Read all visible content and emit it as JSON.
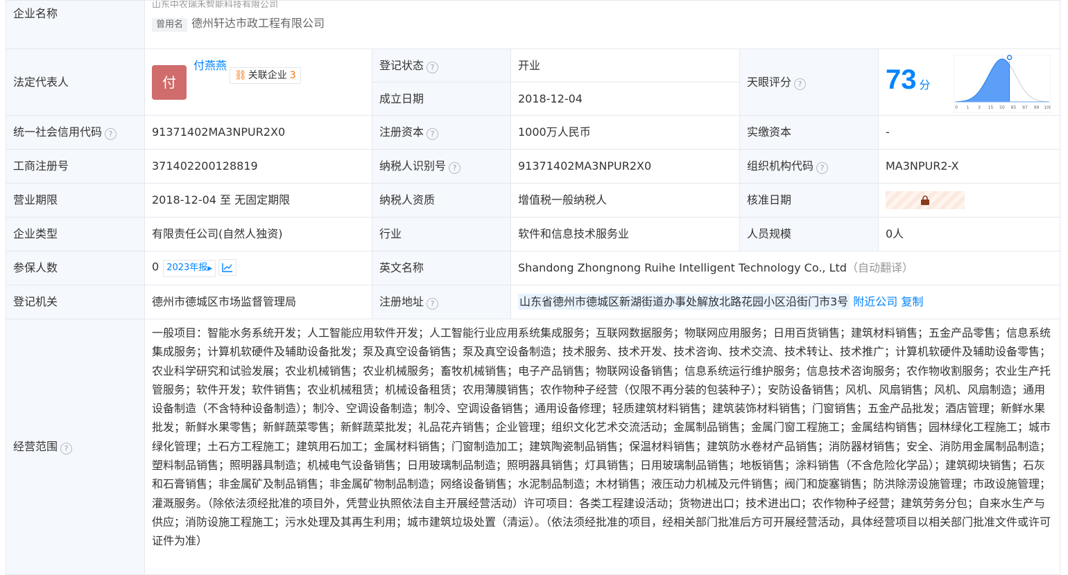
{
  "company_name": {
    "label": "企业名称",
    "current_name_partial": "山东中农瑞禾智能科技有限公司",
    "former_tag": "曾用名",
    "former_name": "德州轩达市政工程有限公司"
  },
  "legal": {
    "label": "法定代表人",
    "avatar_char": "付",
    "name": "付燕燕",
    "related_label": "关联企业",
    "related_count": "3"
  },
  "reg_status": {
    "label": "登记状态",
    "value": "开业"
  },
  "found_date": {
    "label": "成立日期",
    "value": "2018-12-04"
  },
  "score": {
    "label": "天眼评分",
    "value": "73",
    "unit": "分",
    "ticks": [
      "0",
      "1",
      "3",
      "15",
      "50",
      "85",
      "97",
      "99",
      "100"
    ],
    "marker_fraction": 0.58
  },
  "credit_code": {
    "label": "统一社会信用代码",
    "value": "91371402MA3NPUR2X0"
  },
  "reg_capital": {
    "label": "注册资本",
    "value": "1000万人民币"
  },
  "paid_capital": {
    "label": "实缴资本",
    "value": "-"
  },
  "biz_reg_no": {
    "label": "工商注册号",
    "value": "371402200128819"
  },
  "taxpayer_id": {
    "label": "纳税人识别号",
    "value": "91371402MA3NPUR2X0"
  },
  "org_code": {
    "label": "组织机构代码",
    "value": "MA3NPUR2-X"
  },
  "biz_term": {
    "label": "营业期限",
    "value": "2018-12-04 至 无固定期限"
  },
  "taxpayer_qual": {
    "label": "纳税人资质",
    "value": "增值税一般纳税人"
  },
  "approve_date": {
    "label": "核准日期"
  },
  "company_type": {
    "label": "企业类型",
    "value": "有限责任公司(自然人独资)"
  },
  "industry": {
    "label": "行业",
    "value": "软件和信息技术服务业"
  },
  "staff_size": {
    "label": "人员规模",
    "value": "0人"
  },
  "insured": {
    "label": "参保人数",
    "value": "0",
    "year_btn": "2023年报"
  },
  "english_name": {
    "label": "英文名称",
    "value": "Shandong Zhongnong Ruihe Intelligent Technology Co., Ltd",
    "note": "（自动翻译）"
  },
  "reg_authority": {
    "label": "登记机关",
    "value": "德州市德城区市场监督管理局"
  },
  "reg_address": {
    "label": "注册地址",
    "value": "山东省德州市德城区新湖街道办事处解放北路花园小区沿街门市3号",
    "nearby": "附近公司",
    "copy": "复制"
  },
  "scope": {
    "label": "经营范围",
    "value": "一般项目：智能水务系统开发；人工智能应用软件开发；人工智能行业应用系统集成服务；互联网数据服务；物联网应用服务；日用百货销售；建筑材料销售；五金产品零售；信息系统集成服务；计算机软硬件及辅助设备批发；泵及真空设备销售；泵及真空设备制造；技术服务、技术开发、技术咨询、技术交流、技术转让、技术推广；计算机软硬件及辅助设备零售；农业科学研究和试验发展；农业机械销售；农业机械服务；畜牧机械销售；电子产品销售；物联网设备销售；信息系统运行维护服务；信息技术咨询服务；农作物收割服务；农业生产托管服务；软件开发；软件销售；农业机械租赁；机械设备租赁；农用薄膜销售；农作物种子经营（仅限不再分装的包装种子）；安防设备销售；风机、风扇销售；风机、风扇制造；通用设备制造（不含特种设备制造）；制冷、空调设备制造；制冷、空调设备销售；通用设备修理；轻质建筑材料销售；建筑装饰材料销售；门窗销售；五金产品批发；酒店管理；新鲜水果批发；新鲜水果零售；新鲜蔬菜零售；新鲜蔬菜批发；礼品花卉销售；企业管理；组织文化艺术交流活动；金属制品销售；金属门窗工程施工；金属结构销售；园林绿化工程施工；城市绿化管理；土石方工程施工；建筑用石加工；金属材料销售；门窗制造加工；建筑陶瓷制品销售；保温材料销售；建筑防水卷材产品销售；消防器材销售；安全、消防用金属制品制造；塑料制品销售；照明器具制造；机械电气设备销售；日用玻璃制品制造；照明器具销售；灯具销售；日用玻璃制品销售；地板销售；涂料销售（不含危险化学品）；建筑砌块销售；石灰和石膏销售；非金属矿及制品销售；非金属矿物制品制造；网络设备销售；水泥制品制造；木材销售；液压动力机械及元件销售；阀门和旋塞销售；防洪除涝设施管理；市政设施管理；灌溉服务。（除依法须经批准的项目外，凭营业执照依法自主开展经营活动）许可项目：各类工程建设活动；货物进出口；技术进出口；农作物种子经营；建筑劳务分包；自来水生产与供应；消防设施工程施工；污水处理及其再生利用；城市建筑垃圾处置（清运）。（依法须经批准的项目，经相关部门批准后方可开展经营活动，具体经营项目以相关部门批准文件或许可证件为准）"
  },
  "help_icon": "question-circle-icon",
  "colors": {
    "link": "#0084ff",
    "status_green": "#20a53a",
    "avatar": "#d06c6c",
    "label_bg": "#f5f8fc"
  }
}
